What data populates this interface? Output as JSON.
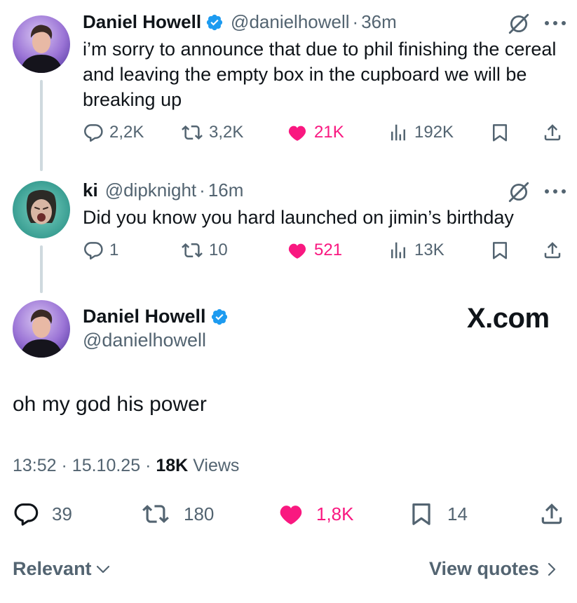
{
  "tweet1": {
    "name": "Daniel Howell",
    "handle": "@danielhowell",
    "time": "36m",
    "text": "i’m sorry to announce that due to phil finishing the cereal and leaving the empty box in the cupboard we will be breaking up",
    "replies": "2,2K",
    "reposts": "3,2K",
    "likes": "21K",
    "views": "192K"
  },
  "tweet2": {
    "name": "ki",
    "handle": "@dipknight",
    "time": "16m",
    "text": "Did you know you hard launched on jimin’s birthday",
    "replies": "1",
    "reposts": "10",
    "likes": "521",
    "views": "13K"
  },
  "main": {
    "name": "Daniel Howell",
    "handle": "@danielhowell",
    "brand": "X.com",
    "text": "oh my god his power",
    "time": "13:52",
    "date": "15.10.25",
    "views_count": "18K",
    "views_label": "Views",
    "replies": "39",
    "reposts": "180",
    "likes": "1,8K",
    "bookmarks": "14"
  },
  "footer": {
    "sort_label": "Relevant",
    "quotes_label": "View quotes"
  },
  "icons": {
    "verified": "verified-badge-icon",
    "grok": "grok-icon",
    "more": "more-icon",
    "reply": "reply-icon",
    "repost": "repost-icon",
    "like": "heart-icon",
    "views": "views-icon",
    "bookmark": "bookmark-icon",
    "share": "share-icon"
  },
  "colors": {
    "verified": "#1d9bf0",
    "like": "#f91880",
    "secondary_text": "#536471",
    "primary_text": "#0f1419"
  }
}
